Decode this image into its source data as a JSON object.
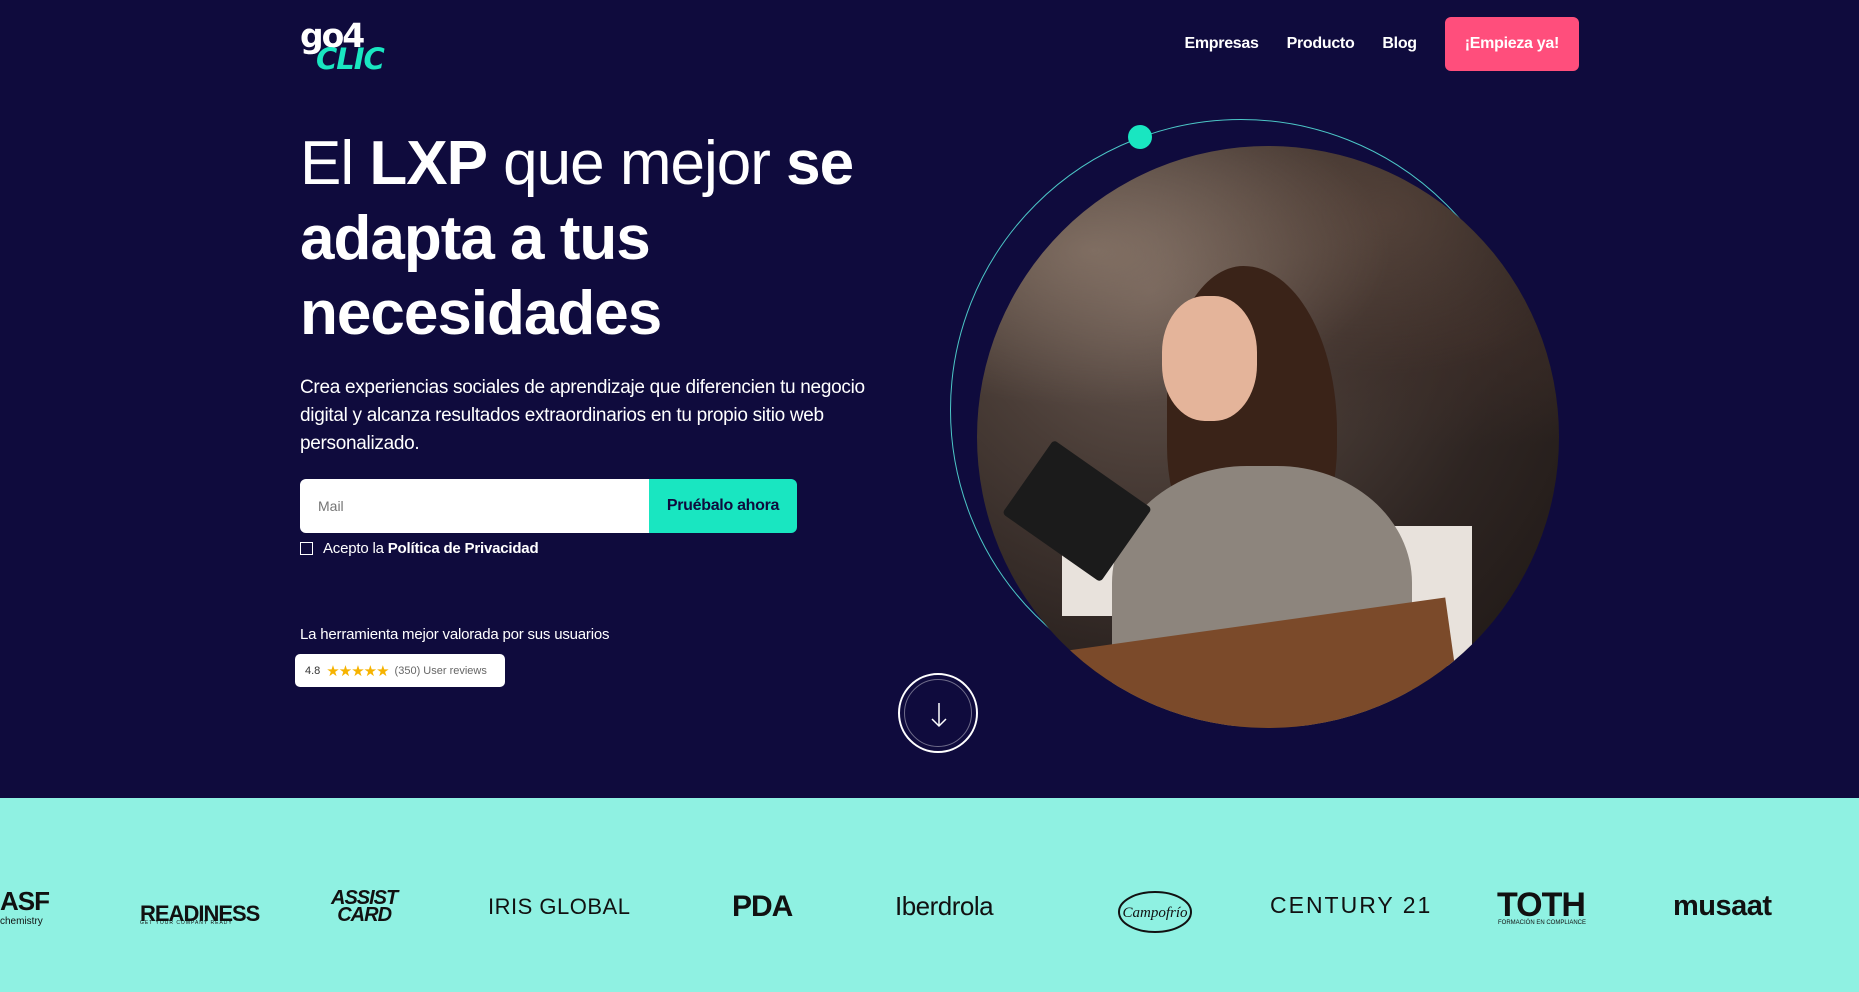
{
  "header": {
    "logo_top": "go4",
    "logo_bottom": "CLIC",
    "nav": [
      "Empresas",
      "Producto",
      "Blog"
    ],
    "cta": "¡Empieza ya!"
  },
  "hero": {
    "title_part1": "El ",
    "title_bold1": "LXP",
    "title_part2": " que mejor ",
    "title_bold2": "se adapta a tus necesidades",
    "lead": "Crea experiencias sociales de aprendizaje que diferencien tu negocio digital y alcanza resultados extraordinarios en tu propio sitio web personalizado.",
    "email_placeholder": "Mail",
    "submit": "Pruébalo ahora",
    "consent_text": "Acepto la",
    "consent_link": "Política de Privacidad",
    "rated_text": "La herramienta mejor valorada por sus usuarios",
    "rating_score": "4.8",
    "rating_stars": "★★★★★",
    "rating_count": "(350) User reviews"
  },
  "colors": {
    "background": "#0f0b3d",
    "accent": "#19e6c1",
    "cta": "#ff4e7c",
    "logo_strip": "#8ff1e2"
  },
  "logos": {
    "basf": "ASF",
    "basf_sub": "chemistry",
    "readiness": "READINESS",
    "readiness_sub": "GET YOUR COMPANY READY",
    "assist_card_1": "ASSIST",
    "assist_card_2": "CARD",
    "iris": "IRIS GLOBAL",
    "pda": "PDA",
    "iberdrola": "Iberdrola",
    "campofrio": "Campofrío",
    "century": "CENTURY 21",
    "toth": "TOTH",
    "toth_sub": "FORMACIÓN EN COMPLIANCE",
    "musaat": "musaat"
  }
}
